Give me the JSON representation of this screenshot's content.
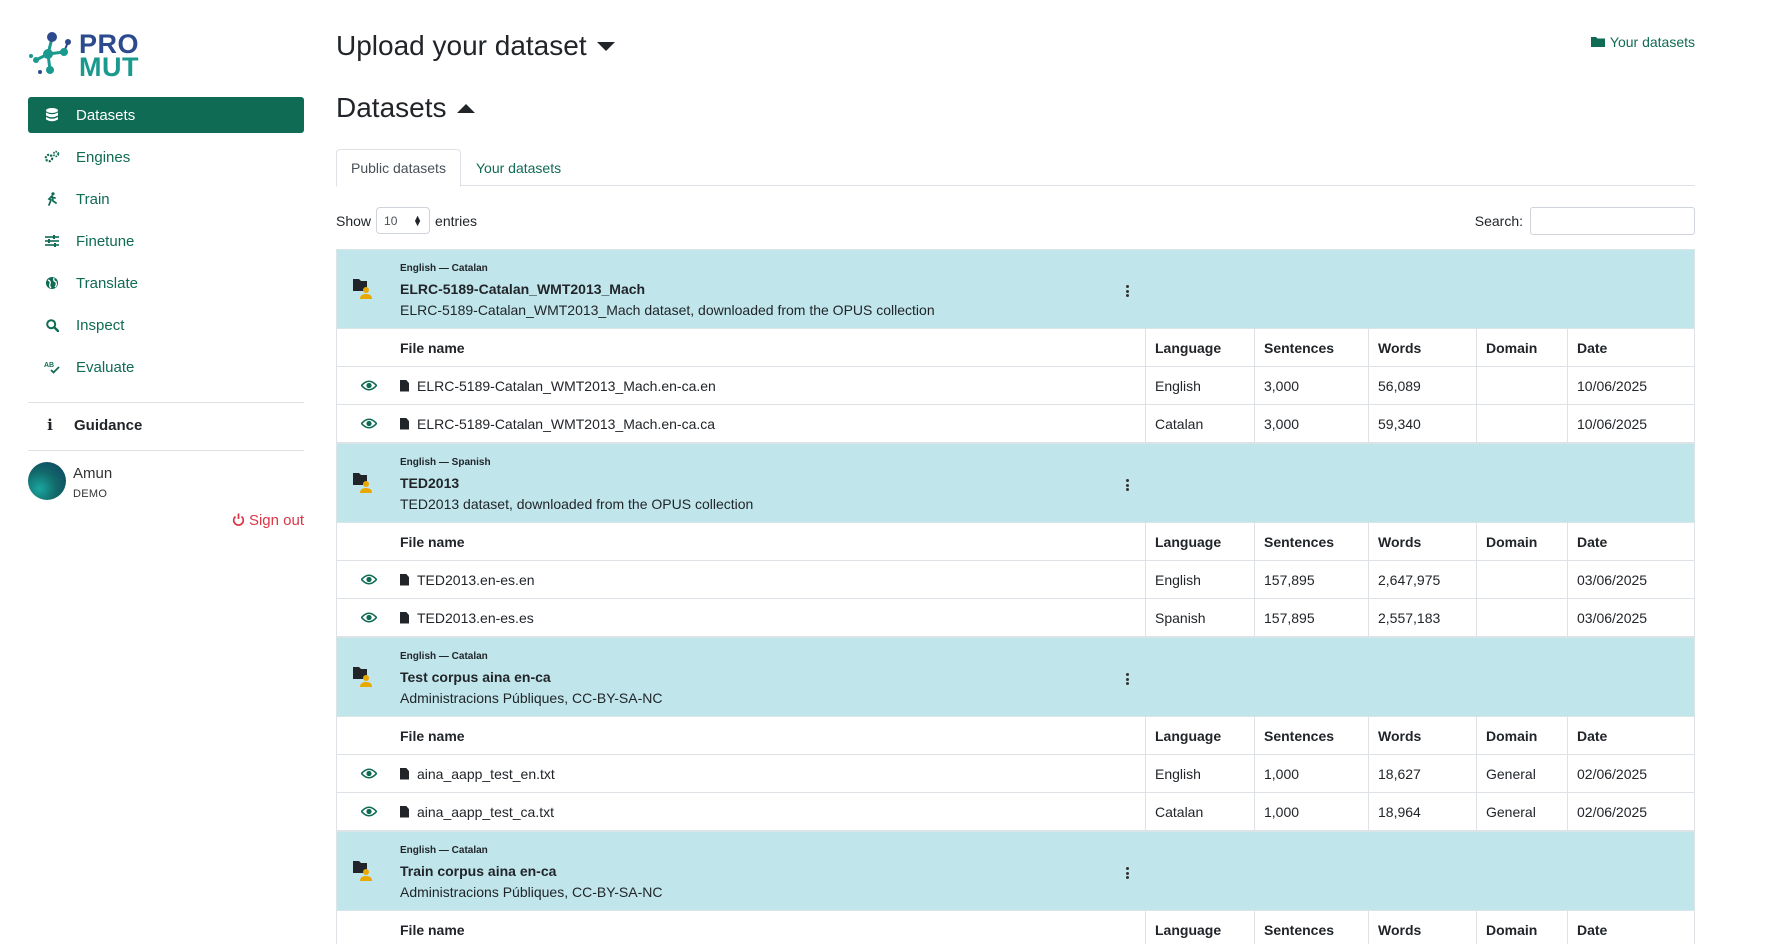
{
  "brand": {
    "line1": "PRO",
    "line2": "MUT"
  },
  "sidebar": {
    "items": [
      {
        "label": "Datasets",
        "icon": "database-icon",
        "active": true
      },
      {
        "label": "Engines",
        "icon": "gears-icon"
      },
      {
        "label": "Train",
        "icon": "running-icon"
      },
      {
        "label": "Finetune",
        "icon": "sliders-icon"
      },
      {
        "label": "Translate",
        "icon": "globe-icon"
      },
      {
        "label": "Inspect",
        "icon": "search-icon"
      },
      {
        "label": "Evaluate",
        "icon": "spellcheck-icon"
      }
    ],
    "guidance": "Guidance",
    "user": {
      "name": "Amun",
      "role": "DEMO"
    },
    "signout": "Sign out"
  },
  "header": {
    "upload_title": "Upload your dataset",
    "datasets_title": "Datasets",
    "your_datasets_link": "Your datasets"
  },
  "tabs": [
    "Public datasets",
    "Your datasets"
  ],
  "controls": {
    "show_label": "Show",
    "page_size": "10",
    "entries_label": "entries",
    "search_label": "Search:",
    "search_value": ""
  },
  "columns": {
    "file": "File name",
    "language": "Language",
    "sentences": "Sentences",
    "words": "Words",
    "domain": "Domain",
    "date": "Date"
  },
  "datasets": [
    {
      "langs": "English — Catalan",
      "name": "ELRC-5189-Catalan_WMT2013_Mach",
      "description": "ELRC-5189-Catalan_WMT2013_Mach dataset, downloaded from the OPUS collection",
      "files": [
        {
          "file": "ELRC-5189-Catalan_WMT2013_Mach.en-ca.en",
          "language": "English",
          "sentences": "3,000",
          "words": "56,089",
          "domain": "",
          "date": "10/06/2025"
        },
        {
          "file": "ELRC-5189-Catalan_WMT2013_Mach.en-ca.ca",
          "language": "Catalan",
          "sentences": "3,000",
          "words": "59,340",
          "domain": "",
          "date": "10/06/2025"
        }
      ]
    },
    {
      "langs": "English — Spanish",
      "name": "TED2013",
      "description": "TED2013 dataset, downloaded from the OPUS collection",
      "files": [
        {
          "file": "TED2013.en-es.en",
          "language": "English",
          "sentences": "157,895",
          "words": "2,647,975",
          "domain": "",
          "date": "03/06/2025"
        },
        {
          "file": "TED2013.en-es.es",
          "language": "Spanish",
          "sentences": "157,895",
          "words": "2,557,183",
          "domain": "",
          "date": "03/06/2025"
        }
      ]
    },
    {
      "langs": "English — Catalan",
      "name": "Test corpus aina en-ca",
      "description": "Administracions Públiques, CC-BY-SA-NC",
      "files": [
        {
          "file": "aina_aapp_test_en.txt",
          "language": "English",
          "sentences": "1,000",
          "words": "18,627",
          "domain": "General",
          "date": "02/06/2025"
        },
        {
          "file": "aina_aapp_test_ca.txt",
          "language": "Catalan",
          "sentences": "1,000",
          "words": "18,964",
          "domain": "General",
          "date": "02/06/2025"
        }
      ]
    },
    {
      "langs": "English — Catalan",
      "name": "Train corpus aina en-ca",
      "description": "Administracions Públiques, CC-BY-SA-NC",
      "files": []
    }
  ],
  "colors": {
    "primary": "#0f6b53",
    "dataset_header": "#c0e6ec",
    "danger": "#dc3545"
  }
}
